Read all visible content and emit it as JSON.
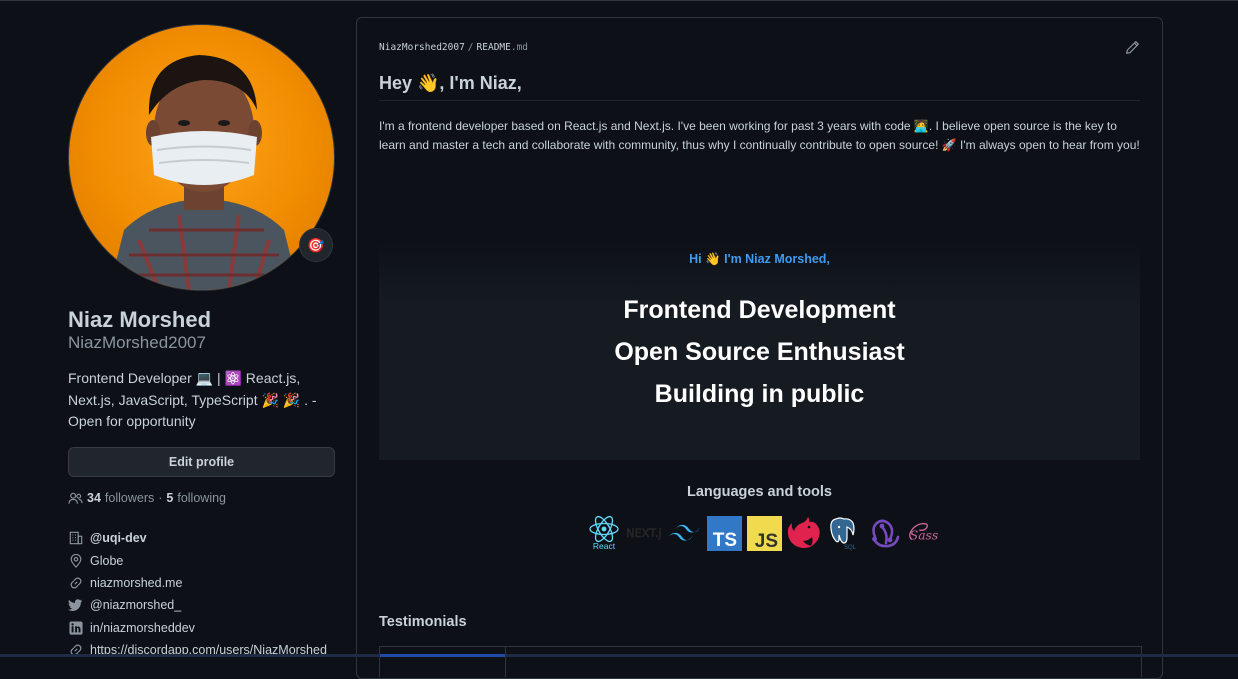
{
  "profile": {
    "name": "Niaz Morshed",
    "login": "NiazMorshed2007",
    "bio": "Frontend Developer 💻 | ⚛️ React.js, Next.js, JavaScript, TypeScript 🎉 🎉 . - Open for opportunity",
    "edit_label": "Edit profile",
    "followers_count": "34",
    "followers_label": "followers",
    "separator": "·",
    "following_count": "5",
    "following_label": "following",
    "status_emoji": "🎯",
    "details": [
      {
        "icon": "organization-icon",
        "text": "@uqi-dev"
      },
      {
        "icon": "location-icon",
        "text": "Globe"
      },
      {
        "icon": "link-icon",
        "text": "niazmorshed.me"
      },
      {
        "icon": "twitter-icon",
        "text": "@niazmorshed_"
      },
      {
        "icon": "linkedin-icon",
        "text": "in/niazmorsheddev"
      },
      {
        "icon": "link-icon",
        "text": "https://discordapp.com/users/NiazMorshed"
      }
    ]
  },
  "readme": {
    "owner": "NiazMorshed2007",
    "path_sep": "/",
    "file_base": "README",
    "file_ext": ".md",
    "heading": "Hey 👋, I'm Niaz,",
    "intro": "I'm a frontend developer based on React.js and Next.js. I've been working for past 3 years with code 🧑‍💻. I believe open source is the key to learn and master a tech and collaborate with community, thus why I continually contribute to open source! 🚀 I'm always open to hear from you!",
    "banner": {
      "greeting": "Hi 👋 I'm Niaz Morshed,",
      "lines": [
        "Frontend Development",
        "Open Source Enthusiast",
        "Building in public"
      ]
    },
    "tools_heading": "Languages and tools",
    "tools": [
      {
        "name": "react-icon",
        "label": "React"
      },
      {
        "name": "nextjs-icon",
        "label": "NEXT.js"
      },
      {
        "name": "tailwind-icon",
        "label": ""
      },
      {
        "name": "typescript-icon",
        "label": "TS"
      },
      {
        "name": "javascript-icon",
        "label": "JS"
      },
      {
        "name": "nestjs-icon",
        "label": ""
      },
      {
        "name": "postgresql-icon",
        "label": "SQL"
      },
      {
        "name": "redux-icon",
        "label": ""
      },
      {
        "name": "sass-icon",
        "label": "Sass"
      }
    ],
    "testimonials_heading": "Testimonials"
  },
  "colors": {
    "background": "#0d1117",
    "border": "#30363d",
    "text": "#c9d1d9",
    "muted": "#8b949e",
    "greeting": "#3f9bf0",
    "avatar_bg": "#f08c00"
  }
}
